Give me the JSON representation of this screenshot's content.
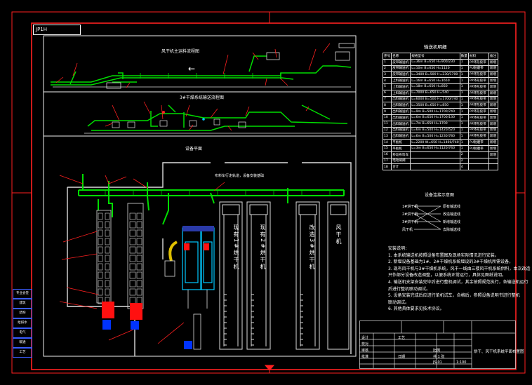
{
  "drawing": {
    "tag": "JP1H",
    "top_view_title": "风干机主运料流程图",
    "side_view_title": "3#干燥系统输送流程图",
    "plan_view_title": "设备平面",
    "plan_header": "布料车行走轨道，设备安装基础",
    "arrow_label": "←",
    "dryers": [
      "现有1#烘干机",
      "现有2#烘干机",
      "改造3#烘干机",
      "风干机"
    ]
  },
  "bom": {
    "title": "输送机明细",
    "headers": [
      "序号",
      "名称",
      "规格型号",
      "数量",
      "材料",
      "备注"
    ],
    "rows": [
      [
        "1",
        "皮带输送机",
        "L=36m B=650 H=900/230",
        "1",
        "PP环形胶带",
        "新增"
      ],
      [
        "2",
        "皮带输送机",
        "L=10m B=650 H=1120",
        "1",
        "PU耐磨带",
        "新增"
      ],
      [
        "3",
        "皮带输送机",
        "L=3400 B=500 H=230/1700",
        "1",
        "PP环形胶带",
        "新增"
      ],
      [
        "4",
        "上料输送机",
        "L=16m B=650 H=1650",
        "1",
        "PP环形胶带",
        "新增"
      ],
      [
        "5",
        "上料输送机",
        "L=18m B=650 H=850",
        "1",
        "PP环形胶带",
        "新增"
      ],
      [
        "6",
        "上料输送机",
        "L=7000 B=650 H=540",
        "1",
        "PP环形胶带",
        "新增"
      ],
      [
        "7",
        "出料输送机",
        "L=6000 B=500 H=1700/740",
        "1",
        "PP环形胶带",
        "新增"
      ],
      [
        "8",
        "出料输送机",
        "L=3500 B=650 H=850",
        "1",
        "PP环形胶带",
        "新增"
      ],
      [
        "9",
        "出料输送机",
        "L=9m B=500 H=1700/740",
        "1",
        "PP环形胶带",
        "新增"
      ],
      [
        "10",
        "出料输送机",
        "L=6m B=650 H=1700/130",
        "1",
        "PP环形胶带",
        "新增"
      ],
      [
        "11",
        "出料输送机",
        "L=7m B=650 H=1700",
        "1",
        "PP环形胶带",
        "新增"
      ],
      [
        "12",
        "出料输送机",
        "L=6m B=500 H=1420/520",
        "1",
        "PP环形胶带",
        "新增"
      ],
      [
        "13",
        "出料输送机",
        "L=6m B=500 H=1230/780",
        "1",
        "PP环形胶带",
        "新增"
      ],
      [
        "14",
        "平板机",
        "L=2200 W=650 H=1400/740",
        "1",
        "PU耐磨带",
        "新增"
      ],
      [
        "15",
        "平板机",
        "L=3m B=650 H=1120/740",
        "1",
        "PU耐磨带",
        "新增"
      ],
      [
        "16",
        "移动布料车",
        "",
        "2",
        "",
        "新增"
      ],
      [
        "17",
        "电动闸阀",
        "",
        "2",
        "",
        ""
      ],
      [
        "18",
        "合计",
        "",
        "4",
        "",
        ""
      ]
    ]
  },
  "legend": {
    "title": "设备连接示意图",
    "left": [
      "1#烘干机",
      "2#烘干机",
      "3#烘干机",
      "风干机"
    ],
    "right": [
      "原有输送线",
      "改造输送线",
      "新增输送线",
      "去除输送线"
    ]
  },
  "notes": {
    "title": "安装说明：",
    "lines": [
      "1. 本系统输送机按照设备布置图及现场实际情况进行安装。",
      "2. 新增设备基础为1#、2#干燥机系统增设的3#干燥机所需设备，",
      "3. 现有风干机与3#干燥机系统，风干一线由三楼风干机系统供料，本次改造",
      "   只作部分设备改造调整，以便系统正常运行，具体见图纸说明。",
      "4. 输送机支架安装完毕后进行整机调试，其余按照规范执行，各输送机运行",
      "   后进行整机联动调试。",
      "5. 设备安装完成后应进行单机试车，合格后，参照设备说明书进行整机",
      "   联动调试。",
      "6. 其他具体要求见技术协议。"
    ]
  },
  "titleblock": {
    "drawing_name": "烘干、风干机系统平面布置图",
    "scale": "1:100",
    "sheet": "共 1 张",
    "number": "JS-01",
    "cells": [
      "设计",
      "校对",
      "审核",
      "批准",
      "工艺",
      "日期",
      "比例",
      "图号"
    ]
  },
  "sidebar": [
    "专业会签",
    "建筑",
    "结构",
    "给排水",
    "电气",
    "暖通",
    "工艺"
  ],
  "colors": {
    "conveyor": "#00dd00",
    "callout": "#ff2020",
    "frame": "#ff2020",
    "machine": "#00c8ff",
    "motor": "#ff1010",
    "base": "#0033ff",
    "chute": "#e0c000",
    "text": "#ffffff"
  }
}
